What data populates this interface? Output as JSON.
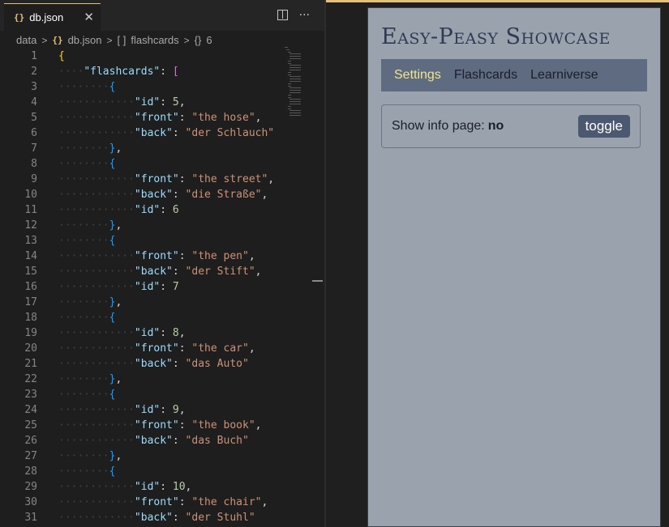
{
  "editor": {
    "tab": {
      "icon": "{}",
      "filename": "db.json",
      "close": "✕"
    },
    "actions": {
      "more": "···"
    },
    "breadcrumb": [
      "data",
      "db.json",
      "flashcards",
      "6"
    ],
    "breadcrumb_icons": {
      "file": "{}",
      "array": "[ ]",
      "object": "{}"
    },
    "lines": [
      {
        "n": "1",
        "indent": 0,
        "html": "<span class='b1'>{</span>"
      },
      {
        "n": "2",
        "indent": 1,
        "html": "<span class='k'>\"flashcards\"</span><span class='p'>: </span><span class='b2'>[</span>"
      },
      {
        "n": "3",
        "indent": 2,
        "html": "<span class='b3'>{</span>"
      },
      {
        "n": "4",
        "indent": 3,
        "html": "<span class='k'>\"id\"</span><span class='p'>: </span><span class='n'>5</span><span class='p'>,</span>"
      },
      {
        "n": "5",
        "indent": 3,
        "html": "<span class='k'>\"front\"</span><span class='p'>: </span><span class='s'>\"the hose\"</span><span class='p'>,</span>"
      },
      {
        "n": "6",
        "indent": 3,
        "html": "<span class='k'>\"back\"</span><span class='p'>: </span><span class='s'>\"der Schlauch\"</span>"
      },
      {
        "n": "7",
        "indent": 2,
        "html": "<span class='b3'>}</span><span class='p'>,</span>"
      },
      {
        "n": "8",
        "indent": 2,
        "html": "<span class='b3'>{</span>"
      },
      {
        "n": "9",
        "indent": 3,
        "html": "<span class='k'>\"front\"</span><span class='p'>: </span><span class='s'>\"the street\"</span><span class='p'>,</span>"
      },
      {
        "n": "10",
        "indent": 3,
        "html": "<span class='k'>\"back\"</span><span class='p'>: </span><span class='s'>\"die Straße\"</span><span class='p'>,</span>"
      },
      {
        "n": "11",
        "indent": 3,
        "html": "<span class='k'>\"id\"</span><span class='p'>: </span><span class='n'>6</span>"
      },
      {
        "n": "12",
        "indent": 2,
        "html": "<span class='b3'>}</span><span class='p'>,</span>"
      },
      {
        "n": "13",
        "indent": 2,
        "html": "<span class='b3'>{</span>"
      },
      {
        "n": "14",
        "indent": 3,
        "html": "<span class='k'>\"front\"</span><span class='p'>: </span><span class='s'>\"the pen\"</span><span class='p'>,</span>"
      },
      {
        "n": "15",
        "indent": 3,
        "html": "<span class='k'>\"back\"</span><span class='p'>: </span><span class='s'>\"der Stift\"</span><span class='p'>,</span>"
      },
      {
        "n": "16",
        "indent": 3,
        "html": "<span class='k'>\"id\"</span><span class='p'>: </span><span class='n'>7</span>"
      },
      {
        "n": "17",
        "indent": 2,
        "html": "<span class='b3'>}</span><span class='p'>,</span>"
      },
      {
        "n": "18",
        "indent": 2,
        "html": "<span class='b3'>{</span>"
      },
      {
        "n": "19",
        "indent": 3,
        "html": "<span class='k'>\"id\"</span><span class='p'>: </span><span class='n'>8</span><span class='p'>,</span>"
      },
      {
        "n": "20",
        "indent": 3,
        "html": "<span class='k'>\"front\"</span><span class='p'>: </span><span class='s'>\"the car\"</span><span class='p'>,</span>"
      },
      {
        "n": "21",
        "indent": 3,
        "html": "<span class='k'>\"back\"</span><span class='p'>: </span><span class='s'>\"das Auto\"</span>"
      },
      {
        "n": "22",
        "indent": 2,
        "html": "<span class='b3'>}</span><span class='p'>,</span>"
      },
      {
        "n": "23",
        "indent": 2,
        "html": "<span class='b3'>{</span>"
      },
      {
        "n": "24",
        "indent": 3,
        "html": "<span class='k'>\"id\"</span><span class='p'>: </span><span class='n'>9</span><span class='p'>,</span>"
      },
      {
        "n": "25",
        "indent": 3,
        "html": "<span class='k'>\"front\"</span><span class='p'>: </span><span class='s'>\"the book\"</span><span class='p'>,</span>"
      },
      {
        "n": "26",
        "indent": 3,
        "html": "<span class='k'>\"back\"</span><span class='p'>: </span><span class='s'>\"das Buch\"</span>"
      },
      {
        "n": "27",
        "indent": 2,
        "html": "<span class='b3'>}</span><span class='p'>,</span>"
      },
      {
        "n": "28",
        "indent": 2,
        "html": "<span class='b3'>{</span>"
      },
      {
        "n": "29",
        "indent": 3,
        "html": "<span class='k'>\"id\"</span><span class='p'>: </span><span class='n'>10</span><span class='p'>,</span>"
      },
      {
        "n": "30",
        "indent": 3,
        "html": "<span class='k'>\"front\"</span><span class='p'>: </span><span class='s'>\"the chair\"</span><span class='p'>,</span>"
      },
      {
        "n": "31",
        "indent": 3,
        "html": "<span class='k'>\"back\"</span><span class='p'>: </span><span class='s'>\"der Stuhl\"</span>"
      }
    ]
  },
  "preview": {
    "title": "Easy-Peasy Showcase",
    "nav": [
      "Settings",
      "Flashcards",
      "Learniverse"
    ],
    "active_nav": "Settings",
    "info_label": "Show info page:",
    "info_value": "no",
    "toggle_label": "toggle"
  },
  "colors": {
    "accent": "#e5c07b",
    "preview_bg": "#9aa2ad",
    "navbar_bg": "#5f6b80",
    "active_nav": "#f0e68c",
    "button_bg": "#4c5870"
  }
}
